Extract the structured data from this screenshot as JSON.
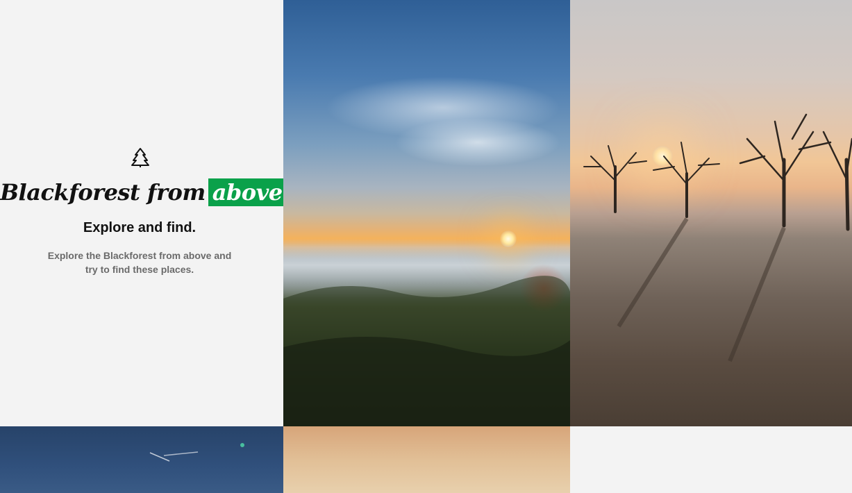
{
  "intro": {
    "icon": "tree-icon",
    "brand_text": "Blackforest from",
    "brand_highlight": "above",
    "subtitle": "Explore and find.",
    "description": "Explore the Blackforest from above and try to find these places."
  },
  "colors": {
    "accent": "#0aa14a",
    "page_background": "#f3f3f3",
    "text_dark": "#111111",
    "text_muted": "#6a6a6a"
  },
  "gallery": {
    "photos": [
      {
        "subject": "aerial sunrise over foggy valley"
      },
      {
        "subject": "frosty field with bare trees at sunrise"
      },
      {
        "subject": "blue sky with contrail"
      },
      {
        "subject": "dawn sky"
      }
    ]
  }
}
